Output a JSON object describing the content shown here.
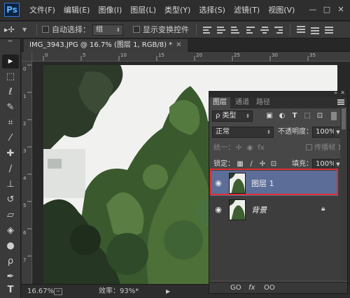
{
  "app": {
    "logo": "Ps",
    "menus": [
      "文件(F)",
      "编辑(E)",
      "图像(I)",
      "图层(L)",
      "类型(Y)",
      "选择(S)",
      "滤镜(T)",
      "视图(V)"
    ],
    "window_buttons": [
      "—",
      "□",
      "✕"
    ]
  },
  "options": {
    "tool_glyph": "▸✢",
    "auto_select_label": "自动选择：",
    "auto_select_value": "组",
    "show_transform_label": "显示变换控件"
  },
  "document": {
    "tab_label": "IMG_3943.JPG @ 16.7% (图层 1, RGB/8) *",
    "ruler_top_labels": [
      "0",
      "5",
      "10",
      "15",
      "20",
      "25",
      "30",
      "35"
    ],
    "ruler_left_labels": [
      "0",
      "1",
      "2",
      "3",
      "4",
      "5",
      "6",
      "7"
    ]
  },
  "status": {
    "zoom": "16.67%",
    "efficiency": "效率：93%*"
  },
  "layers_panel": {
    "tabs": [
      "图层",
      "通道",
      "路径"
    ],
    "filter_kind": "ρ 类型",
    "blend_mode": "正常",
    "opacity_label": "不透明度：",
    "opacity_value": "100%",
    "unify_label": "统一：",
    "propagate_label": "传播帧 1",
    "lock_label": "锁定：",
    "fill_label": "填充：",
    "fill_value": "100%",
    "layers": [
      {
        "name": "图层 1",
        "selected": true
      },
      {
        "name": "背景",
        "selected": false,
        "locked": true
      }
    ],
    "bottom_icons": [
      "GO",
      "fx",
      "ОО"
    ]
  }
}
